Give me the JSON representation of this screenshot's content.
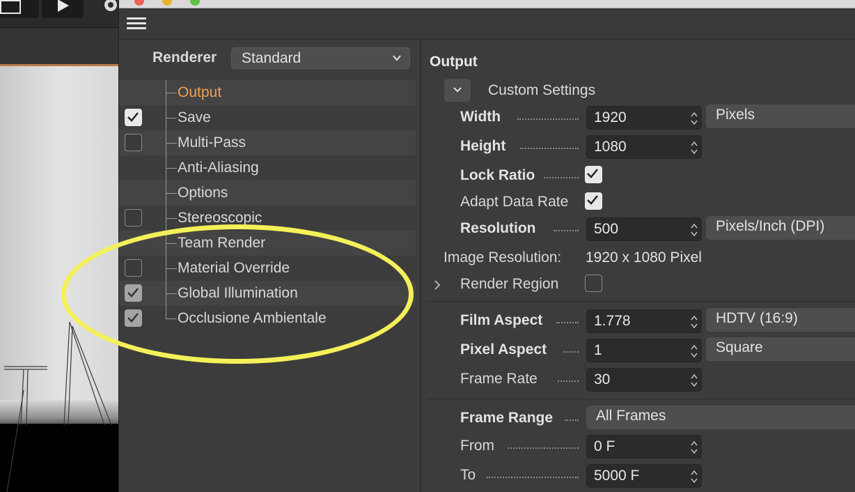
{
  "menu": {
    "icon": "hamburger-icon"
  },
  "renderer": {
    "label": "Renderer",
    "value": "Standard",
    "icon": "chevron-down-icon"
  },
  "tree": [
    {
      "label": "Output",
      "checkbox": "none",
      "active": true
    },
    {
      "label": "Save",
      "checkbox": "checked",
      "active": false
    },
    {
      "label": "Multi-Pass",
      "checkbox": "unchecked",
      "active": false
    },
    {
      "label": "Anti-Aliasing",
      "checkbox": "none",
      "active": false
    },
    {
      "label": "Options",
      "checkbox": "none",
      "active": false
    },
    {
      "label": "Stereoscopic",
      "checkbox": "unchecked",
      "active": false
    },
    {
      "label": "Team Render",
      "checkbox": "none",
      "active": false
    },
    {
      "label": "Material Override",
      "checkbox": "unchecked",
      "active": false
    },
    {
      "label": "Global Illumination",
      "checkbox": "checked-dim",
      "active": false
    },
    {
      "label": "Occlusione Ambientale",
      "checkbox": "checked-dim",
      "active": false
    }
  ],
  "output": {
    "title": "Output",
    "preset": "Custom Settings",
    "width": {
      "label": "Width",
      "value": "1920",
      "unit": "Pixels"
    },
    "height": {
      "label": "Height",
      "value": "1080"
    },
    "lock_ratio": {
      "label": "Lock Ratio",
      "checked": true
    },
    "adapt_data_rate": {
      "label": "Adapt Data Rate",
      "checked": true
    },
    "resolution": {
      "label": "Resolution",
      "value": "500",
      "unit": "Pixels/Inch (DPI)"
    },
    "image_resolution": {
      "label": "Image Resolution:",
      "value": "1920 x 1080 Pixel"
    },
    "render_region": {
      "label": "Render Region",
      "checked": false
    },
    "film_aspect": {
      "label": "Film Aspect",
      "value": "1.778",
      "unit": "HDTV (16:9)"
    },
    "pixel_aspect": {
      "label": "Pixel Aspect",
      "value": "1",
      "unit": "Square"
    },
    "frame_rate": {
      "label": "Frame Rate",
      "value": "30"
    },
    "frame_range": {
      "label": "Frame Range",
      "value": "All Frames"
    },
    "from": {
      "label": "From",
      "value": "0 F"
    },
    "to": {
      "label": "To",
      "value": "5000 F"
    }
  },
  "colors": {
    "accent": "#f0a24f",
    "highlight_ellipse": "#f3f05a",
    "panel": "#3c3c3c"
  }
}
